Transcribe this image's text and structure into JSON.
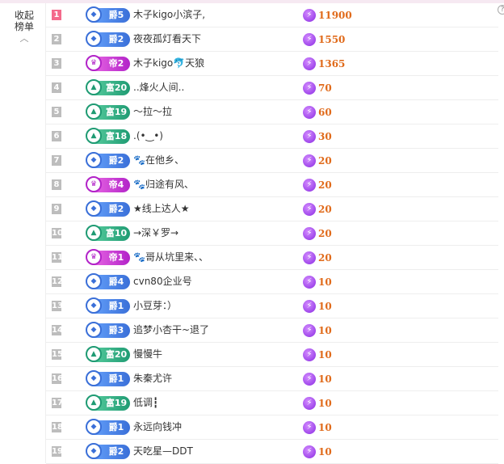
{
  "collapse": {
    "line1": "收起",
    "line2": "榜单",
    "caret": "︿"
  },
  "help_icon_glyph": "?",
  "rows": [
    {
      "rank": "1",
      "badge_type": "jue",
      "badge": "爵5",
      "name": "木子kigo小滨子,",
      "points": "11900"
    },
    {
      "rank": "2",
      "badge_type": "jue",
      "badge": "爵2",
      "name": "夜夜孤灯看天下",
      "points": "1550"
    },
    {
      "rank": "3",
      "badge_type": "di",
      "badge": "帝2",
      "name": "木子kigo🐬天狼",
      "points": "1365"
    },
    {
      "rank": "4",
      "badge_type": "fu",
      "badge": "富20",
      "name": "..烽火人间..",
      "points": "70"
    },
    {
      "rank": "5",
      "badge_type": "fu",
      "badge": "富19",
      "name": "～拉～拉",
      "points": "60"
    },
    {
      "rank": "6",
      "badge_type": "fu",
      "badge": "富18",
      "name": ".(•‿•)",
      "points": "30"
    },
    {
      "rank": "7",
      "badge_type": "jue",
      "badge": "爵2",
      "name": "🐾在他乡、",
      "points": "20"
    },
    {
      "rank": "8",
      "badge_type": "di",
      "badge": "帝4",
      "name": "🐾归途有风、",
      "points": "20"
    },
    {
      "rank": "9",
      "badge_type": "jue",
      "badge": "爵2",
      "name": "★线上达人★",
      "points": "20"
    },
    {
      "rank": "10",
      "badge_type": "fu",
      "badge": "富10",
      "name": "→深￥罗→",
      "points": "20"
    },
    {
      "rank": "11",
      "badge_type": "di",
      "badge": "帝1",
      "name": "🐾哥从坑里来、、",
      "points": "20"
    },
    {
      "rank": "12",
      "badge_type": "jue",
      "badge": "爵4",
      "name": "cvn80企业号",
      "points": "10"
    },
    {
      "rank": "13",
      "badge_type": "jue",
      "badge": "爵1",
      "name": "小豆芽：）",
      "points": "10"
    },
    {
      "rank": "14",
      "badge_type": "jue",
      "badge": "爵3",
      "name": "追梦小杏干~退了",
      "points": "10"
    },
    {
      "rank": "15",
      "badge_type": "fu",
      "badge": "富20",
      "name": "慢慢牛",
      "points": "10"
    },
    {
      "rank": "16",
      "badge_type": "jue",
      "badge": "爵1",
      "name": "朱秦尤许",
      "points": "10"
    },
    {
      "rank": "17",
      "badge_type": "fu",
      "badge": "富19",
      "name": "低调┇",
      "points": "10"
    },
    {
      "rank": "18",
      "badge_type": "jue",
      "badge": "爵1",
      "name": "永远向钱冲",
      "points": "10"
    },
    {
      "rank": "19",
      "badge_type": "jue",
      "badge": "爵2",
      "name": "天吃星—DDT",
      "points": "10"
    }
  ],
  "colors": {
    "top_rank": "#f46a8c",
    "rank": "#bdbdbd",
    "points": "#e06a1a",
    "jue_badge": "#3a6fd8",
    "fu_badge": "#1f9b73",
    "di_badge": "#b223c8"
  },
  "icons": {
    "points": "lightning-coin-icon",
    "jue_gem": "diamond-icon",
    "fu_gem": "triangle-icon",
    "di_gem": "crown-icon",
    "collapse": "chevron-up-icon",
    "help": "help-icon"
  }
}
